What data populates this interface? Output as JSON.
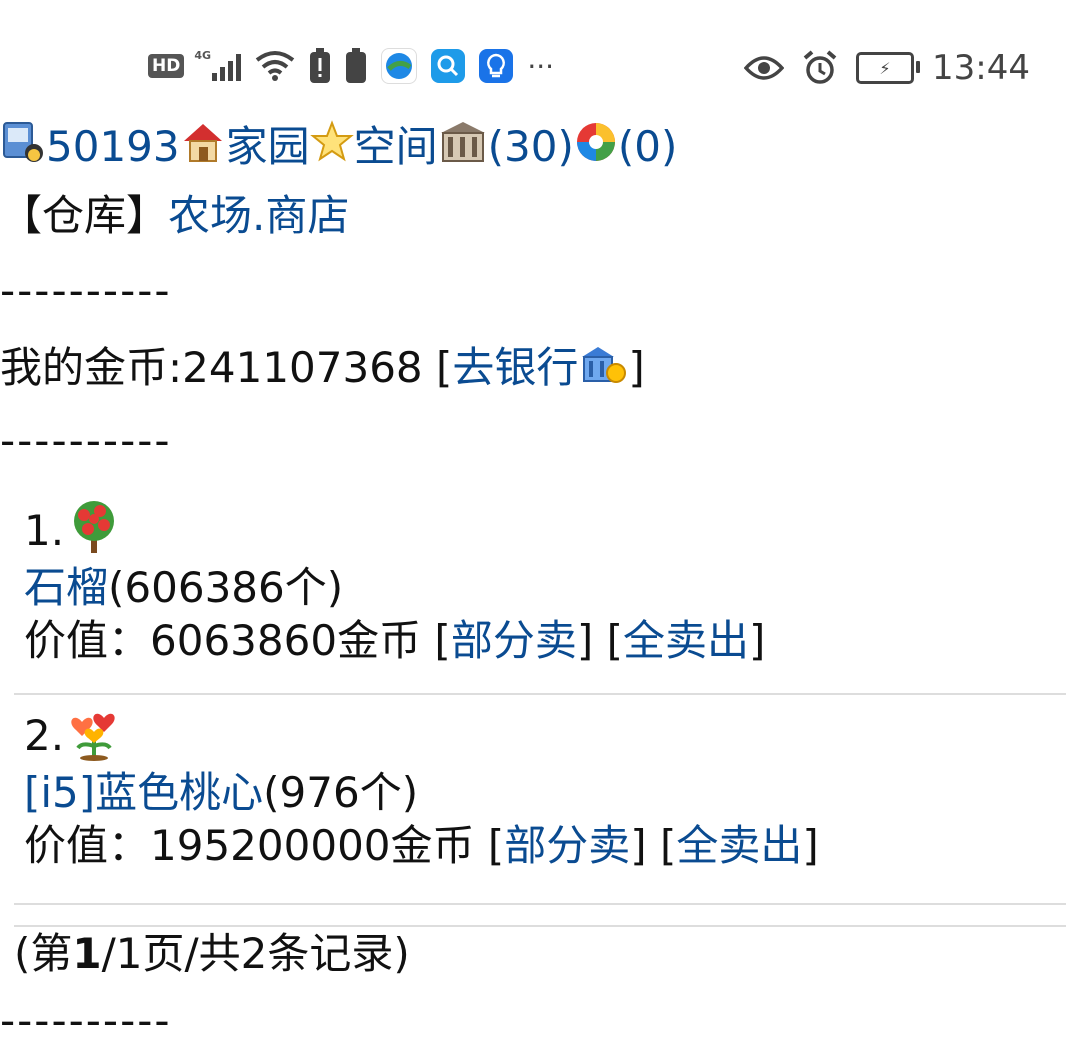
{
  "status_bar": {
    "hd": "HD",
    "network": "4G",
    "time": "13:44",
    "icons": [
      "hd-icon",
      "signal-icon",
      "wifi-icon",
      "battery-alert-icon",
      "battery-icon",
      "browser-icon",
      "search-app-icon",
      "bulb-app-icon",
      "more-icon",
      "eye-icon",
      "alarm-icon",
      "battery-charging-icon"
    ]
  },
  "header": {
    "user_id": "50193",
    "home_label": "家园",
    "space_label": "空间",
    "building_count": "(30)",
    "aperture_count": "(0)"
  },
  "nav": {
    "current": "【仓库】",
    "farm": "农场",
    "dot": ".",
    "shop": "商店"
  },
  "divider": "----------",
  "gold": {
    "label": "我的金币:",
    "amount": "241107368",
    "bank_open": " [",
    "bank_link": "去银行",
    "bank_close": "]"
  },
  "items": [
    {
      "index": "1.",
      "name": "石榴",
      "count": "(606386个)",
      "value_label": "价值：",
      "value": "6063860金币",
      "sell_part": "部分卖",
      "sell_all": "全卖出"
    },
    {
      "index": "2.",
      "name": "[i5]蓝色桃心",
      "count": "(976个)",
      "value_label": "价值：",
      "value": "195200000金币",
      "sell_part": "部分卖",
      "sell_all": "全卖出"
    }
  ],
  "pager": {
    "prefix": "(第",
    "current": "1",
    "suffix": "/1页/共2条记录)"
  }
}
